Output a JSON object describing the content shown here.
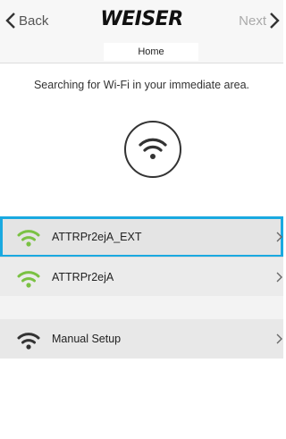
{
  "nav": {
    "back_label": "Back",
    "brand": "WEISER",
    "next_label": "Next",
    "breadcrumb": "Home"
  },
  "main": {
    "status_text": "Searching for Wi-Fi in your immediate area.",
    "status_icon": "wifi-icon"
  },
  "networks": [
    {
      "label": "ATTRPr2ejA_EXT",
      "icon": "wifi-icon",
      "icon_color": "#7ac143",
      "selected": true
    },
    {
      "label": "ATTRPr2ejA",
      "icon": "wifi-icon",
      "icon_color": "#7ac143",
      "selected": false
    }
  ],
  "manual": {
    "label": "Manual Setup",
    "icon": "wifi-icon",
    "icon_color": "#333333"
  },
  "colors": {
    "highlight": "#1aa9e0",
    "wifi_green": "#7ac143"
  }
}
